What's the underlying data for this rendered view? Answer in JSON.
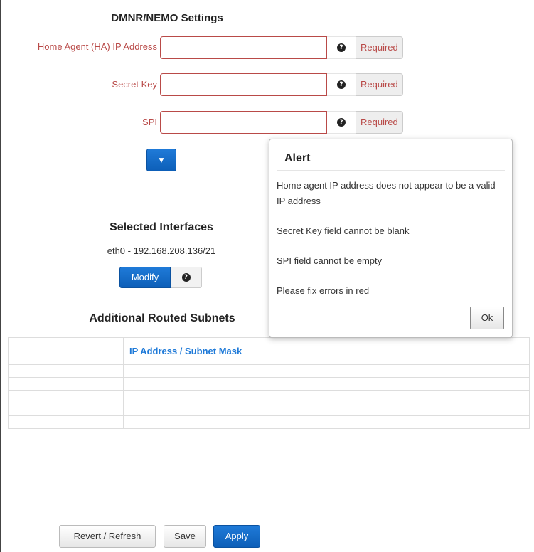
{
  "settings": {
    "title": "DMNR/NEMO Settings",
    "fields": [
      {
        "label": "Home Agent (HA) IP Address",
        "value": "",
        "required_text": "Required"
      },
      {
        "label": "Secret Key",
        "value": "",
        "required_text": "Required"
      },
      {
        "label": "SPI",
        "value": "",
        "required_text": "Required"
      }
    ],
    "help_glyph": "?",
    "expand_icon": "▼"
  },
  "interfaces": {
    "title": "Selected Interfaces",
    "value": "eth0 - 192.168.208.136/21",
    "modify_label": "Modify"
  },
  "subnets": {
    "title": "Additional Routed Subnets",
    "column_header": "IP Address / Subnet Mask",
    "rows": [
      "",
      "",
      "",
      "",
      ""
    ]
  },
  "footer": {
    "revert_label": "Revert / Refresh",
    "save_label": "Save",
    "apply_label": "Apply"
  },
  "alert": {
    "title": "Alert",
    "messages": [
      "Home agent IP address does not appear to be a valid IP address",
      "Secret Key field cannot be blank",
      "SPI field cannot be empty",
      "Please fix errors in red"
    ],
    "ok_label": "Ok"
  },
  "colors": {
    "error": "#b94a48",
    "primary": "#1f7ad8",
    "header_link": "#1f7ad8"
  },
  "icons": {
    "help": "question-circle-icon",
    "expand": "caret-down-icon"
  }
}
